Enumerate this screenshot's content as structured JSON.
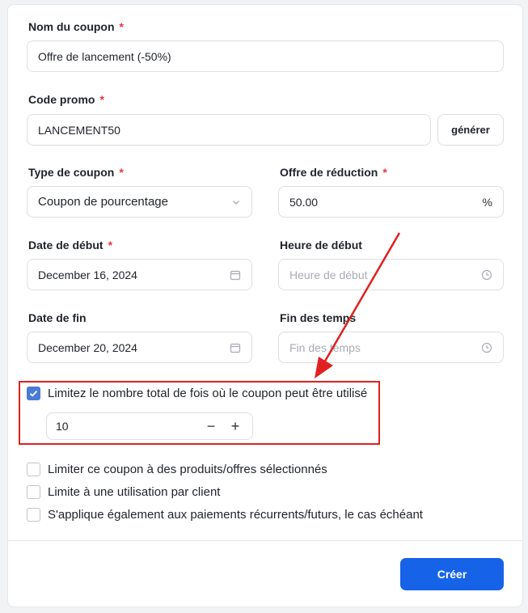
{
  "form": {
    "coupon_name": {
      "label": "Nom du coupon",
      "required": "*",
      "value": "Offre de lancement (-50%)"
    },
    "promo_code": {
      "label": "Code promo",
      "required": "*",
      "value": "LANCEMENT50",
      "generate_label": "générer"
    },
    "coupon_type": {
      "label": "Type de coupon",
      "required": "*",
      "value": "Coupon de pourcentage",
      "icon": "chevron-down-icon"
    },
    "discount": {
      "label": "Offre de réduction",
      "required": "*",
      "value": "50.00",
      "suffix": "%"
    },
    "start_date": {
      "label": "Date de début",
      "required": "*",
      "value": "December 16, 2024",
      "icon": "calendar-icon"
    },
    "start_time": {
      "label": "Heure de début",
      "placeholder": "Heure de début",
      "icon": "clock-icon"
    },
    "end_date": {
      "label": "Date de fin",
      "value": "December 20, 2024",
      "icon": "calendar-icon"
    },
    "end_time": {
      "label": "Fin des temps",
      "placeholder": "Fin des temps",
      "icon": "clock-icon"
    },
    "limit_total": {
      "checked": true,
      "label": "Limitez le nombre total de fois où le coupon peut être utilisé",
      "value": "10",
      "decrement": "−",
      "increment": "+"
    },
    "options": [
      {
        "checked": false,
        "label": "Limiter ce coupon à des produits/offres sélectionnés"
      },
      {
        "checked": false,
        "label": "Limite à une utilisation par client"
      },
      {
        "checked": false,
        "label": "S'applique également aux paiements récurrents/futurs, le cas échéant"
      }
    ],
    "submit_label": "Créer"
  },
  "colors": {
    "accent": "#1663e8",
    "checkbox": "#4a7bd6",
    "required": "#e5353b",
    "annotation": "#e02020"
  }
}
